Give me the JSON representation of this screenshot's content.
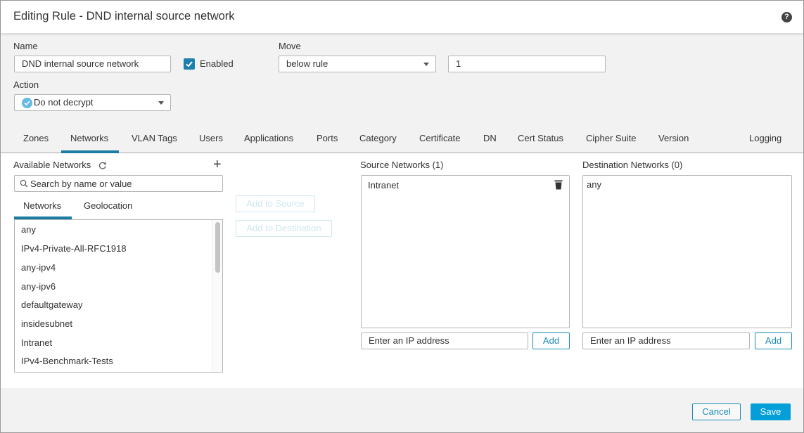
{
  "dialog": {
    "title": "Editing Rule - DND internal source network",
    "help_icon_glyph": "?"
  },
  "form": {
    "name_label": "Name",
    "name_value": "DND internal source network",
    "enabled_label": "Enabled",
    "enabled_checked": true,
    "move_label": "Move",
    "move_value": "below rule",
    "move_position_value": "1",
    "action_label": "Action",
    "action_value": "Do not decrypt"
  },
  "tabs": [
    {
      "label": "Zones"
    },
    {
      "label": "Networks",
      "active": true
    },
    {
      "label": "VLAN Tags"
    },
    {
      "label": "Users"
    },
    {
      "label": "Applications"
    },
    {
      "label": "Ports"
    },
    {
      "label": "Category"
    },
    {
      "label": "Certificate"
    },
    {
      "label": "DN"
    },
    {
      "label": "Cert Status"
    },
    {
      "label": "Cipher Suite"
    },
    {
      "label": "Version"
    },
    {
      "label": "Logging"
    }
  ],
  "available": {
    "title": "Available Networks",
    "search_placeholder": "Search by name or value",
    "subtabs": [
      {
        "label": "Networks",
        "active": true
      },
      {
        "label": "Geolocation"
      }
    ],
    "items": [
      "any",
      "IPv4-Private-All-RFC1918",
      "any-ipv4",
      "any-ipv6",
      "defaultgateway",
      "insidesubnet",
      "Intranet",
      "IPv4-Benchmark-Tests"
    ]
  },
  "actions": {
    "add_to_source": "Add to Source",
    "add_to_destination": "Add to Destination"
  },
  "source": {
    "title": "Source Networks (1)",
    "items": [
      "Intranet"
    ],
    "ip_placeholder": "Enter an IP address",
    "add_label": "Add"
  },
  "destination": {
    "title": "Destination Networks (0)",
    "items": [
      "any"
    ],
    "ip_placeholder": "Enter an IP address",
    "add_label": "Add"
  },
  "footer": {
    "cancel_label": "Cancel",
    "save_label": "Save"
  },
  "colors": {
    "accent": "#1b7ba3",
    "primary_button": "#049fd9",
    "checkbox": "#1e7fae"
  }
}
